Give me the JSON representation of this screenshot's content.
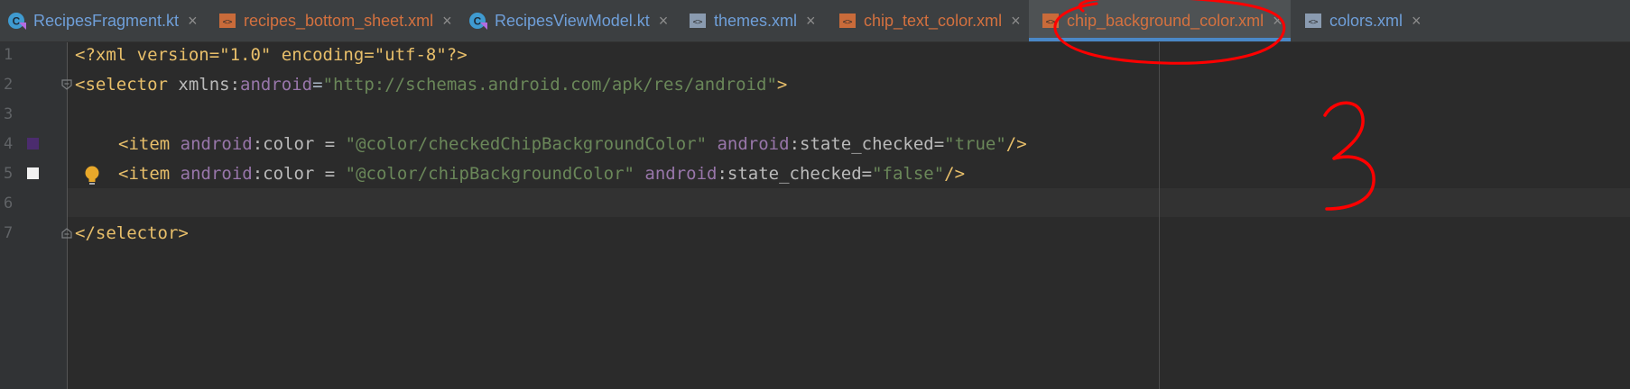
{
  "tabs": [
    {
      "label": "RecipesFragment.kt",
      "type": "kotlin",
      "active": false
    },
    {
      "label": "recipes_bottom_sheet.xml",
      "type": "xml",
      "active": false
    },
    {
      "label": "RecipesViewModel.kt",
      "type": "kotlin",
      "active": false
    },
    {
      "label": "themes.xml",
      "type": "xml-values",
      "active": false
    },
    {
      "label": "chip_text_color.xml",
      "type": "xml",
      "active": false
    },
    {
      "label": "chip_background_color.xml",
      "type": "xml",
      "active": true
    },
    {
      "label": "colors.xml",
      "type": "xml-values",
      "active": false
    }
  ],
  "tab_close_glyph": "×",
  "line_numbers": [
    "1",
    "2",
    "3",
    "4",
    "5",
    "6",
    "7"
  ],
  "code": {
    "line1": {
      "a": "<?xml version=\"1.0\" encoding=\"utf-8\"?>"
    },
    "line2": {
      "open": "<selector ",
      "attr_prefix": "xmlns:",
      "attr_ns": "android",
      "eq": "=",
      "value": "\"http://schemas.android.com/apk/res/android\"",
      "close": ">"
    },
    "line4": {
      "open": "<item ",
      "ns1": "android",
      "attr1": ":color = ",
      "val1": "\"@color/checkedChipBackgroundColor\"",
      "ns2": " android",
      "attr2": ":state_checked=",
      "val2": "\"true\"",
      "close": "/>"
    },
    "line5": {
      "open": "<item ",
      "ns1": "android",
      "attr1": ":color = ",
      "val1": "\"@color/chipBackgroundColor\"",
      "ns2": " android",
      "attr2": ":state_checked=",
      "val2": "\"false\"",
      "close": "/>"
    },
    "line7": {
      "a": "</selector>"
    }
  },
  "annotation": {
    "handwritten_text": "3",
    "color": "#ff0000"
  },
  "colors": {
    "checked_chip_swatch": "#4b2c6e",
    "chip_swatch": "#f2f2f2",
    "bulb": "#e8a82a"
  }
}
